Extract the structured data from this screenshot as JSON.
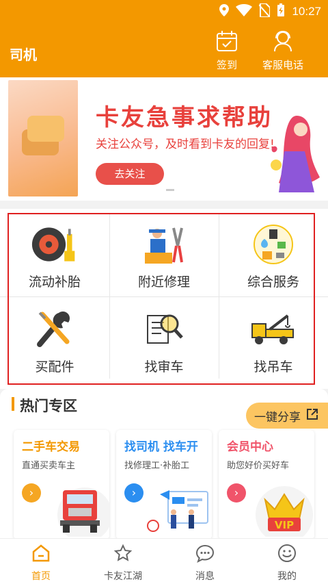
{
  "status_bar": {
    "time": "10:27"
  },
  "header": {
    "title": "司机",
    "checkin_label": "签到",
    "service_label": "客服电话"
  },
  "banner": {
    "title": "卡友急事求帮助",
    "subtitle": "关注公众号，及时看到卡友的回复!",
    "button_label": "去关注"
  },
  "services": [
    {
      "label": "流动补胎",
      "icon": "tire-icon"
    },
    {
      "label": "附近修理",
      "icon": "mechanic-icon"
    },
    {
      "label": "综合服务",
      "icon": "services-icon"
    },
    {
      "label": "买配件",
      "icon": "tools-icon"
    },
    {
      "label": "找审车",
      "icon": "inspection-icon"
    },
    {
      "label": "找吊车",
      "icon": "crane-truck-icon"
    }
  ],
  "hot_zone": {
    "title": "热门专区",
    "share_label": "一键分享",
    "cards": [
      {
        "title": "二手车交易",
        "subtitle": "直通买卖车主",
        "color": "#f39800"
      },
      {
        "title": "找司机  找车开",
        "subtitle": "找修理工·补胎工",
        "color": "#2b8ef0"
      },
      {
        "title": "会员中心",
        "subtitle": "助您好价买好车",
        "color": "#f0546a"
      }
    ]
  },
  "nav": {
    "items": [
      {
        "label": "首页"
      },
      {
        "label": "卡友江湖"
      },
      {
        "label": "消息"
      },
      {
        "label": "我的"
      }
    ]
  },
  "colors": {
    "accent": "#f39800",
    "banner_red": "#e8413c",
    "highlight_border": "#e02020"
  }
}
